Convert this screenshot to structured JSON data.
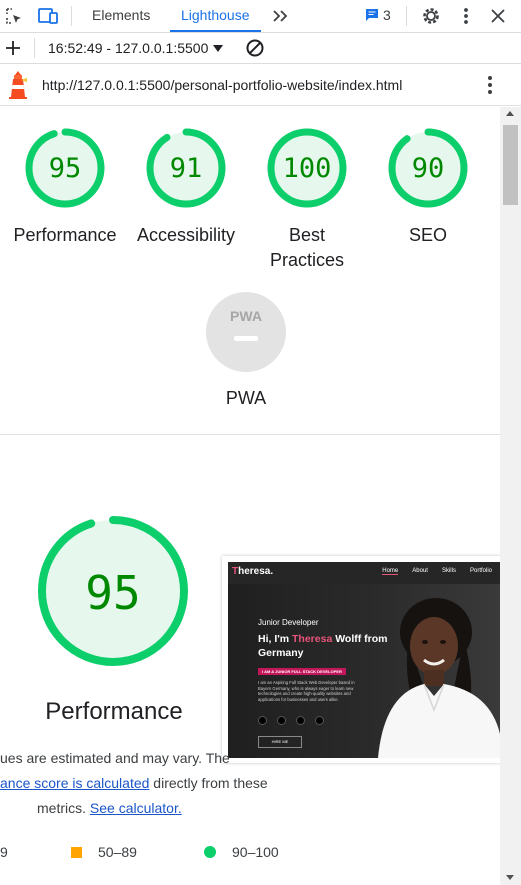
{
  "devtools": {
    "tabs": [
      {
        "label": "Elements",
        "active": false
      },
      {
        "label": "Lighthouse",
        "active": true
      }
    ],
    "message_count": "3",
    "icons": [
      "inspect-icon",
      "device-toggle-icon",
      "more-tabs-icon",
      "messages-icon",
      "settings-gear-icon",
      "kebab-menu-icon",
      "close-icon"
    ]
  },
  "toolbar": {
    "report_selector": "16:52:49 - 127.0.0.1:5500"
  },
  "report": {
    "url": "http://127.0.0.1:5500/personal-portfolio-website/index.html",
    "categories": [
      {
        "label": "Performance",
        "score": 95
      },
      {
        "label": "Accessibility",
        "score": 91
      },
      {
        "label": "Best Practices",
        "score": 100
      },
      {
        "label": "SEO",
        "score": 90
      }
    ],
    "pwa": {
      "label": "PWA",
      "badge_text": "PWA"
    },
    "performance_section": {
      "score": 95,
      "title": "Performance",
      "note_line1": "ues are estimated and may vary. The",
      "note_link1": "ance score is calculated",
      "note_line2_rest": " directly from these",
      "note_line3_pre": "metrics. ",
      "note_link2": "See calculator.",
      "legend": [
        {
          "label": "9",
          "color": "#ff4e42"
        },
        {
          "label": "50–89",
          "color": "#ffa400"
        },
        {
          "label": "90–100",
          "color": "#0cce6b"
        }
      ]
    },
    "colors": {
      "pass_green": "#0cce6b",
      "pass_green_text": "#008800",
      "gauge_fill": "#e6f8ed",
      "pwa_grey": "#e3e3e3"
    },
    "screenshot": {
      "logo_initial": "T",
      "logo_rest": "heresa.",
      "nav": [
        "Home",
        "About",
        "Skills",
        "Portfolio"
      ],
      "role": "Junior Developer",
      "greeting_pre": "Hi, I'm ",
      "greeting_name": "Theresa",
      "greeting_post": " Wolff from Germany",
      "pill": "I AM A JUNIOR FULL STACK DEVELOPER",
      "blurb": "I am an Aspiring Full Stack Web Developer based in Bayern Germany, who is always eager to learn new technologies and create high-quality websites and applications for businesses and users alike.",
      "hire_button": "HIRE ME"
    }
  }
}
